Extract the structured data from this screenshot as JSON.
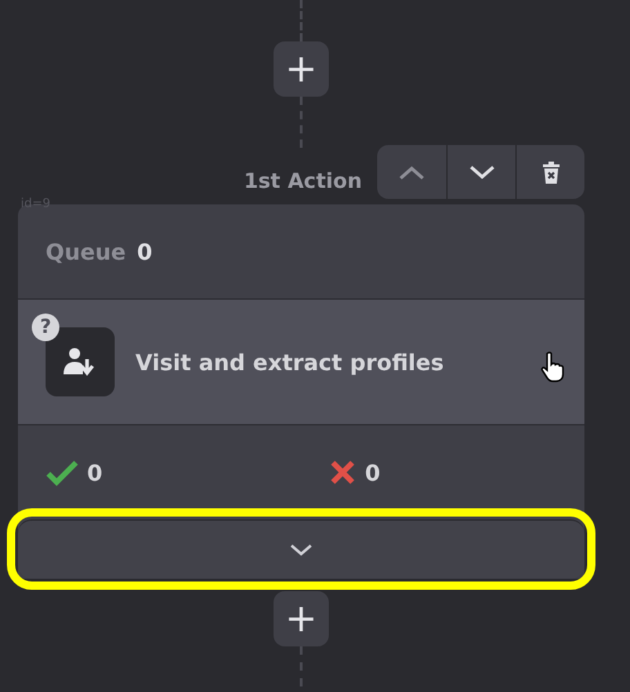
{
  "add_buttons": [
    {
      "label": "+"
    },
    {
      "label": "+"
    }
  ],
  "action": {
    "title": "1st Action",
    "id_label": "id=9",
    "queue": {
      "label": "Queue",
      "count": "0"
    },
    "step": {
      "title": "Visit and extract profiles",
      "help": "?"
    },
    "stats": {
      "success": "0",
      "failed": "0"
    },
    "expand_button": {
      "highlighted": true
    }
  }
}
